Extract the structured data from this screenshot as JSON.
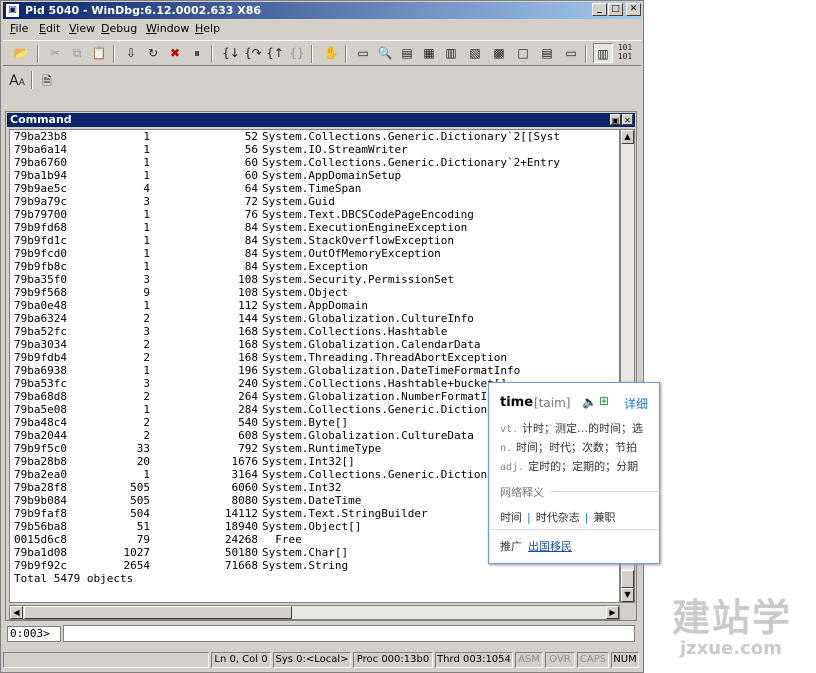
{
  "window": {
    "title": "Pid 5040 - WinDbg:6.12.0002.633 X86",
    "minimize": "_",
    "maximize": "□",
    "close": "✕"
  },
  "menu": [
    {
      "label": "File",
      "key": "F",
      "rest": "ile"
    },
    {
      "label": "Edit",
      "key": "E",
      "rest": "dit"
    },
    {
      "label": "View",
      "key": "V",
      "rest": "iew"
    },
    {
      "label": "Debug",
      "key": "D",
      "rest": "ebug"
    },
    {
      "label": "Window",
      "key": "W",
      "rest": "indow"
    },
    {
      "label": "Help",
      "key": "H",
      "rest": "elp"
    }
  ],
  "toolbar": {
    "font_icon_label": "A",
    "binary_icon_label": "101"
  },
  "command_panel": {
    "title": "Command",
    "rows": [
      {
        "mt": "79ba23b8",
        "count": "1",
        "size": "52",
        "name": "System.Collections.Generic.Dictionary`2[[Syst"
      },
      {
        "mt": "79ba6a14",
        "count": "1",
        "size": "56",
        "name": "System.IO.StreamWriter"
      },
      {
        "mt": "79ba6760",
        "count": "1",
        "size": "60",
        "name": "System.Collections.Generic.Dictionary`2+Entry"
      },
      {
        "mt": "79ba1b94",
        "count": "1",
        "size": "60",
        "name": "System.AppDomainSetup"
      },
      {
        "mt": "79b9ae5c",
        "count": "4",
        "size": "64",
        "name": "System.TimeSpan"
      },
      {
        "mt": "79b9a79c",
        "count": "3",
        "size": "72",
        "name": "System.Guid"
      },
      {
        "mt": "79b79700",
        "count": "1",
        "size": "76",
        "name": "System.Text.DBCSCodePageEncoding"
      },
      {
        "mt": "79b9fd68",
        "count": "1",
        "size": "84",
        "name": "System.ExecutionEngineException"
      },
      {
        "mt": "79b9fd1c",
        "count": "1",
        "size": "84",
        "name": "System.StackOverflowException"
      },
      {
        "mt": "79b9fcd0",
        "count": "1",
        "size": "84",
        "name": "System.OutOfMemoryException"
      },
      {
        "mt": "79b9fb8c",
        "count": "1",
        "size": "84",
        "name": "System.Exception"
      },
      {
        "mt": "79ba35f0",
        "count": "3",
        "size": "108",
        "name": "System.Security.PermissionSet"
      },
      {
        "mt": "79b9f568",
        "count": "9",
        "size": "108",
        "name": "System.Object"
      },
      {
        "mt": "79ba0e48",
        "count": "1",
        "size": "112",
        "name": "System.AppDomain"
      },
      {
        "mt": "79ba6324",
        "count": "2",
        "size": "144",
        "name": "System.Globalization.CultureInfo"
      },
      {
        "mt": "79ba52fc",
        "count": "3",
        "size": "168",
        "name": "System.Collections.Hashtable"
      },
      {
        "mt": "79ba3034",
        "count": "2",
        "size": "168",
        "name": "System.Globalization.CalendarData"
      },
      {
        "mt": "79b9fdb4",
        "count": "2",
        "size": "168",
        "name": "System.Threading.ThreadAbortException"
      },
      {
        "mt": "79ba6938",
        "count": "1",
        "size": "196",
        "name": "System.Globalization.DateTimeFormatInfo"
      },
      {
        "mt": "79ba53fc",
        "count": "3",
        "size": "240",
        "name": "System.Collections.Hashtable+bucket[]"
      },
      {
        "mt": "79ba68d8",
        "count": "2",
        "size": "264",
        "name": "System.Globalization.NumberFormatInfo"
      },
      {
        "mt": "79ba5e08",
        "count": "1",
        "size": "284",
        "name": "System.Collections.Generic.Dictionary"
      },
      {
        "mt": "79ba48c4",
        "count": "2",
        "size": "540",
        "name": "System.Byte[]"
      },
      {
        "mt": "79ba2044",
        "count": "2",
        "size": "608",
        "name": "System.Globalization.CultureData"
      },
      {
        "mt": "79b9f5c0",
        "count": "33",
        "size": "792",
        "name": "System.RuntimeType"
      },
      {
        "mt": "79ba28b8",
        "count": "20",
        "size": "1676",
        "name": "System.Int32[]"
      },
      {
        "mt": "79ba2ea0",
        "count": "1",
        "size": "3164",
        "name": "System.Collections.Generic.Dictionary"
      },
      {
        "mt": "79ba28f8",
        "count": "505",
        "size": "6060",
        "name": "System.Int32"
      },
      {
        "mt": "79b9b084",
        "count": "505",
        "size": "8080",
        "name": "System.DateTime"
      },
      {
        "mt": "79b9faf8",
        "count": "504",
        "size": "14112",
        "name": "System.Text.StringBuilder"
      },
      {
        "mt": "79b56ba8",
        "count": "51",
        "size": "18940",
        "name": "System.Object[]"
      },
      {
        "mt": "0015d6c8",
        "count": "79",
        "size": "24268",
        "name": "  Free"
      },
      {
        "mt": "79ba1d08",
        "count": "1027",
        "size": "50180",
        "name": "System.Char[]"
      },
      {
        "mt": "79b9f92c",
        "count": "2654",
        "size": "71668",
        "name": "System.String"
      }
    ],
    "total": "Total 5479 objects"
  },
  "command_line": {
    "prompt": "0:003>",
    "value": ""
  },
  "status": {
    "position": "Ln 0, Col 0",
    "sys": "Sys 0:<Local>",
    "proc": "Proc 000:13b0",
    "thrd": "Thrd 003:1054",
    "asm": "ASM",
    "ovr": "OVR",
    "caps": "CAPS",
    "num": "NUM"
  },
  "dictionary_popup": {
    "word": "time",
    "phonetic": "[taim]",
    "detail_link": "详细",
    "definitions": [
      {
        "pos": "vt.",
        "text": "计时；测定…的时间；选"
      },
      {
        "pos": "n.",
        "text": "时间；时代；次数；节拍"
      },
      {
        "pos": "adj.",
        "text": "定时的；定期的；分期"
      }
    ],
    "web_section": "网络释义",
    "tags": [
      "时间",
      "时代杂志",
      "兼职"
    ],
    "promo_label": "推广",
    "promo_link": "出国移民"
  },
  "watermark": {
    "cn": "建站学",
    "url": "jzxue.com"
  }
}
